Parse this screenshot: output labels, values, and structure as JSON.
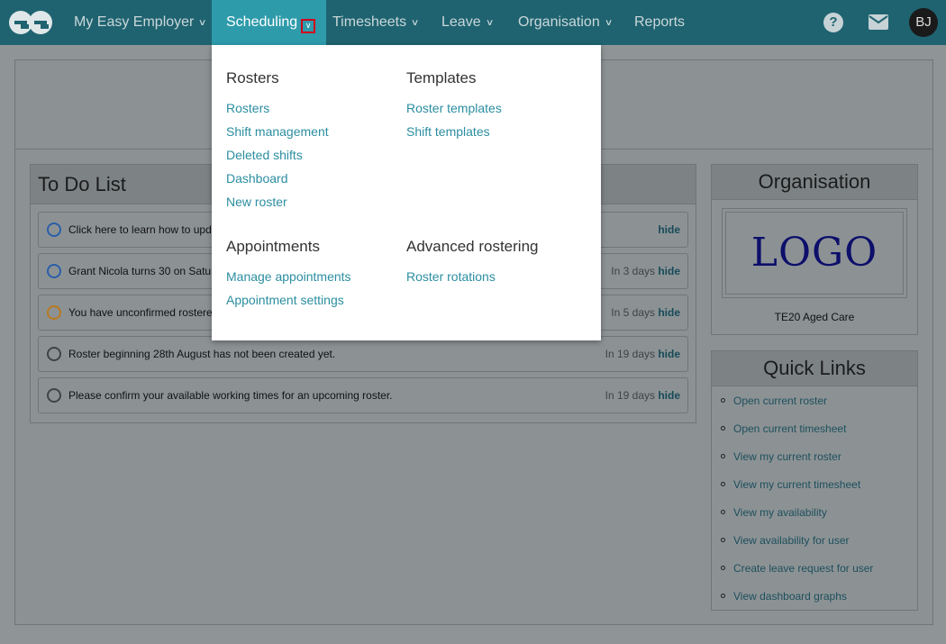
{
  "nav": {
    "brand": "ce",
    "items": [
      {
        "label": "My Easy Employer",
        "has_chevron": true
      },
      {
        "label": "Scheduling",
        "has_chevron": true,
        "active": true
      },
      {
        "label": "Timesheets",
        "has_chevron": true
      },
      {
        "label": "Leave",
        "has_chevron": true
      },
      {
        "label": "Organisation",
        "has_chevron": true
      },
      {
        "label": "Reports",
        "has_chevron": false
      }
    ],
    "user_initials": "BJ"
  },
  "dropdown": {
    "sections": [
      {
        "heading": "Rosters",
        "links": [
          "Rosters",
          "Shift management",
          "Deleted shifts",
          "Dashboard",
          "New roster"
        ]
      },
      {
        "heading": "Templates",
        "links": [
          "Roster templates",
          "Shift templates"
        ]
      },
      {
        "heading": "Appointments",
        "links": [
          "Manage appointments",
          "Appointment settings"
        ]
      },
      {
        "heading": "Advanced rostering",
        "links": [
          "Roster rotations"
        ]
      }
    ]
  },
  "todo": {
    "title": "To Do List",
    "hide_label": "hide",
    "items": [
      {
        "text": "Click here to learn how to upd",
        "due": "",
        "status_color": "#2a5ea8"
      },
      {
        "text": "Grant Nicola turns 30 on Satur",
        "due": "In 3 days",
        "status_color": "#2a5ea8"
      },
      {
        "text": "You have unconfirmed rostere",
        "due": "In 5 days",
        "status_color": "#b9791f"
      },
      {
        "text": "Roster beginning 28th August has not been created yet.",
        "due": "In 19 days",
        "status_color": "#3f4445"
      },
      {
        "text": "Please confirm your available working times for an upcoming roster.",
        "due": "In 19 days",
        "status_color": "#3f4445"
      }
    ]
  },
  "organisation": {
    "title": "Organisation",
    "logo_text": "LOGO",
    "name": "TE20 Aged Care"
  },
  "quick_links": {
    "title": "Quick Links",
    "items": [
      "Open current roster",
      "Open current timesheet",
      "View my current roster",
      "View my current timesheet",
      "View my availability",
      "View availability for user",
      "Create leave request for user",
      "View dashboard graphs"
    ]
  },
  "colors": {
    "nav_bg": "#1f6370",
    "nav_active": "#2e9bab",
    "link": "#2b8ea0",
    "overlay_page": "#8f9596"
  },
  "icons": {
    "help": "help-icon",
    "mail": "mail-icon",
    "chevron": "chevron-down-icon"
  }
}
